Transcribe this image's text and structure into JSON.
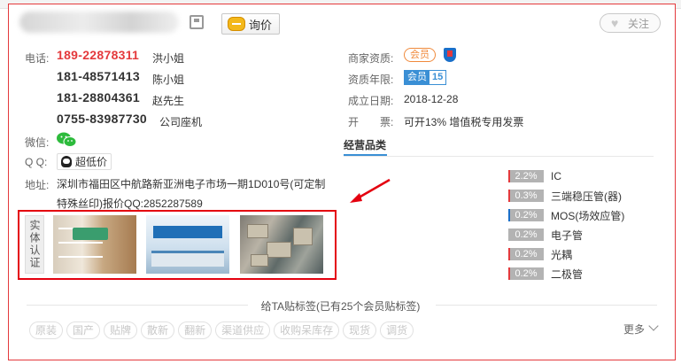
{
  "header": {
    "inquiry_label": "询价",
    "follow_label": "关注"
  },
  "contact": {
    "phone_label": "电话:",
    "phones": [
      {
        "number": "189-22878311",
        "name": "洪小姐"
      },
      {
        "number": "181-48571413",
        "name": "陈小姐"
      },
      {
        "number": "181-28804361",
        "name": "赵先生"
      },
      {
        "number": "0755-83987730",
        "name": "公司座机"
      }
    ],
    "wechat_label": "微信:",
    "qq_label": "Q Q:",
    "qq_button": "超低价",
    "address_label": "地址:",
    "address": "深圳市福田区中航路新亚洲电子市场一期1D010号(可定制特殊丝印)报价QQ:2852287589"
  },
  "certification": {
    "tag": "实体认证"
  },
  "merchant": {
    "qualification_label": "商家资质:",
    "qualification_badge": "会员",
    "years_label": "资质年限:",
    "years_badge_text": "会员",
    "years_badge_num": "15",
    "founded_label": "成立日期:",
    "founded_value": "2018-12-28",
    "invoice_label": "开　　票:",
    "invoice_value": "可开13% 增值税专用发票"
  },
  "categories": {
    "tab": "经营品类",
    "items": [
      {
        "pct": "2.2%",
        "name": "IC",
        "accent": "#e4393c"
      },
      {
        "pct": "0.3%",
        "name": "三端稳压管(器)",
        "accent": "#e4393c"
      },
      {
        "pct": "0.2%",
        "name": "MOS(场效应管)",
        "accent": "#1a6fc9"
      },
      {
        "pct": "0.2%",
        "name": "电子管",
        "accent": "#b3b3b3"
      },
      {
        "pct": "0.2%",
        "name": "光耦",
        "accent": "#e4393c"
      },
      {
        "pct": "0.2%",
        "name": "二极管",
        "accent": "#e4393c"
      }
    ]
  },
  "tags": {
    "title": "给TA贴标签(已有25个会员贴标签)",
    "items": [
      "原装",
      "国产",
      "贴牌",
      "散新",
      "翻新",
      "渠道供应",
      "收购呆库存",
      "现货",
      "调货"
    ],
    "more": "更多"
  },
  "colors": {
    "accent_red": "#e4393c",
    "accent_blue": "#3a8fd5"
  }
}
